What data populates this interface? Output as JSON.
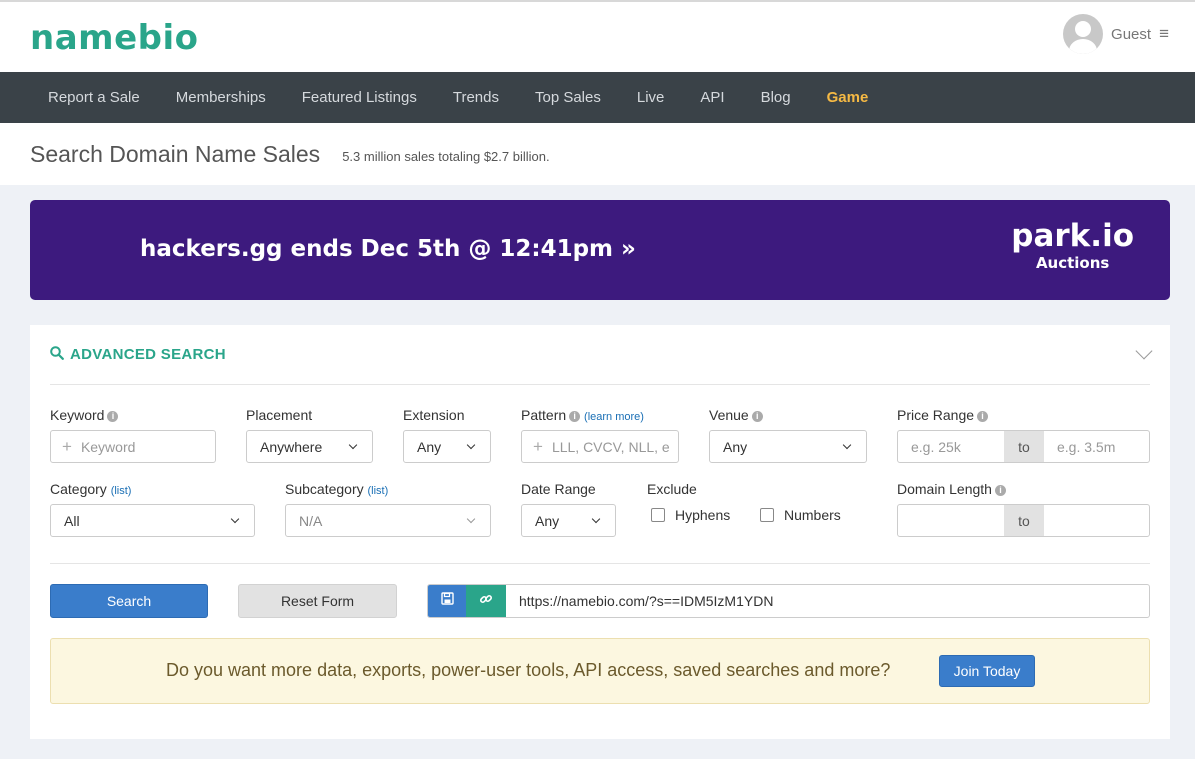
{
  "header": {
    "logo": "namebio",
    "user_label": "Guest"
  },
  "nav": {
    "items": [
      "Report a Sale",
      "Memberships",
      "Featured Listings",
      "Trends",
      "Top Sales",
      "Live",
      "API",
      "Blog",
      "Game"
    ]
  },
  "page": {
    "title": "Search Domain Name Sales",
    "subtitle": "5.3 million sales totaling $2.7 billion."
  },
  "banner": {
    "text": "hackers.gg ends Dec 5th @ 12:41pm »",
    "brand": "park.io",
    "brand_sub": "Auctions",
    "color": "#3d1a7e"
  },
  "search": {
    "title": "ADVANCED SEARCH",
    "keyword": {
      "label": "Keyword",
      "placeholder": "Keyword"
    },
    "placement": {
      "label": "Placement",
      "value": "Anywhere"
    },
    "extension": {
      "label": "Extension",
      "value": "Any"
    },
    "pattern": {
      "label": "Pattern",
      "learn_more": "(learn more)",
      "placeholder": "LLL, CVCV, NLL, e"
    },
    "venue": {
      "label": "Venue",
      "value": "Any"
    },
    "price_range": {
      "label": "Price Range",
      "from_placeholder": "e.g. 25k",
      "to": "to",
      "to_placeholder": "e.g. 3.5m"
    },
    "category": {
      "label": "Category",
      "list": "(list)",
      "value": "All"
    },
    "subcategory": {
      "label": "Subcategory",
      "list": "(list)",
      "value": "N/A"
    },
    "date_range": {
      "label": "Date Range",
      "value": "Any"
    },
    "exclude": {
      "label": "Exclude",
      "hyphens": "Hyphens",
      "numbers": "Numbers"
    },
    "domain_length": {
      "label": "Domain Length",
      "to": "to"
    },
    "search_button": "Search",
    "reset_button": "Reset Form",
    "share_url": "https://namebio.com/?s==IDM5IzM1YDN"
  },
  "promo": {
    "text": "Do you want more data, exports, power-user tools, API access, saved searches and more?",
    "button": "Join Today"
  },
  "colors": {
    "accent": "#2aa58a",
    "primary_button": "#3a7dcb",
    "nav_bg": "#3a4248",
    "nav_highlight": "#f5b944"
  }
}
